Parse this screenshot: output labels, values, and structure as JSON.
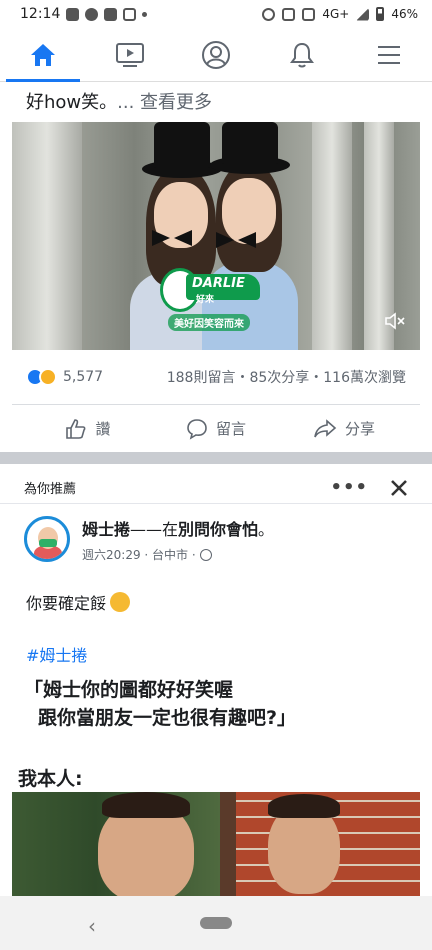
{
  "status_bar": {
    "time": "12:14",
    "network": "4G+",
    "battery": "46%"
  },
  "nav": {
    "tabs": [
      {
        "name": "home",
        "icon": "home-icon",
        "active": true
      },
      {
        "name": "watch",
        "icon": "video-icon",
        "active": false
      },
      {
        "name": "profile",
        "icon": "profile-icon",
        "active": false
      },
      {
        "name": "notifications",
        "icon": "bell-icon",
        "active": false
      },
      {
        "name": "menu",
        "icon": "menu-icon",
        "active": false
      }
    ]
  },
  "post1": {
    "text": "好how笑。",
    "see_more": "... 查看更多",
    "ad_brand": "DARLIE",
    "ad_brand_cn": "好來",
    "ad_slogan": "美好因笑容而來",
    "reactions_count": "5,577",
    "stats": "188則留言・85次分享・116萬次瀏覽",
    "actions": {
      "like": "讚",
      "comment": "留言",
      "share": "分享"
    }
  },
  "suggested": {
    "header": "為你推薦"
  },
  "post2": {
    "author": "姆士捲",
    "connector": "——在",
    "place": "別問你會怕",
    "period": "。",
    "meta": "週六20:29 · 台中市 ·",
    "body": "你要確定餒",
    "hashtag": "#姆士捲",
    "quote_line1": "「姆士你的圖都好好笑喔",
    "quote_line2": "跟你當朋友一定也很有趣吧?」",
    "me_label": "我本人:"
  },
  "colors": {
    "accent": "#1877f2",
    "ad_green": "#0f9b4c"
  }
}
